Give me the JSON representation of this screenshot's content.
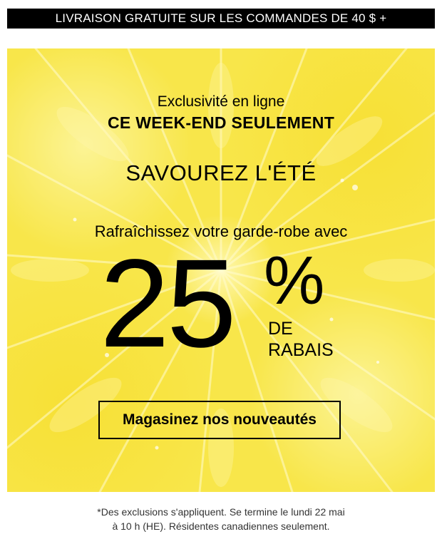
{
  "top_banner": {
    "label": "LIVRAISON GRATUITE SUR LES COMMANDES DE 40 $ +"
  },
  "hero": {
    "eyebrow": "Exclusivité en ligne",
    "subhead": "CE WEEK-END SEULEMENT",
    "headline": "SAVOUREZ L'ÉTÉ",
    "lead": "Rafraîchissez votre garde-robe avec",
    "discount_value": "25",
    "discount_symbol": "%",
    "discount_line1": "DE",
    "discount_line2": "RABAIS",
    "cta_label": "Magasinez nos nouveautés",
    "background_image": "lemon-slice-texture"
  },
  "footer": {
    "disclaimer_line1": "*Des exclusions s'appliquent. Se termine le lundi 22 mai",
    "disclaimer_line2": "à 10 h (HE). Résidentes canadiennes seulement."
  },
  "colors": {
    "banner_bg": "#000000",
    "banner_text": "#ffffff",
    "hero_yellow": "#f8e64a",
    "text": "#000000"
  }
}
